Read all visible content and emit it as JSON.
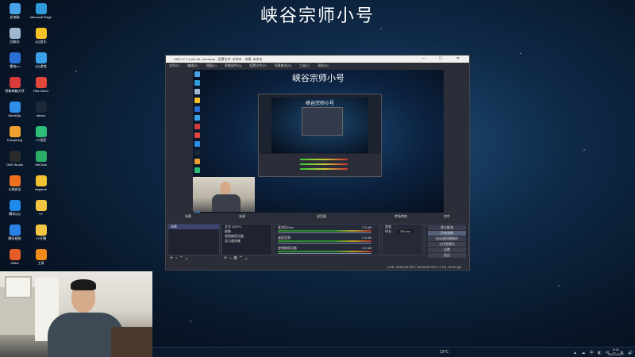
{
  "stream_title": "峡谷宗师小号",
  "desktop_icons": [
    {
      "label": "此电脑",
      "color": "#4aa3e6"
    },
    {
      "label": "Microsoft Edge",
      "color": "#2f9bd8"
    },
    {
      "label": "回收站",
      "color": "#9fb7cf"
    },
    {
      "label": "QQ音乐",
      "color": "#f6c026"
    },
    {
      "label": "雷电Ln",
      "color": "#2a6fd6"
    },
    {
      "label": "QQ游戏",
      "color": "#3aa0e8"
    },
    {
      "label": "网易邮箱大师",
      "color": "#d73b3b"
    },
    {
      "label": "Riot Client",
      "color": "#e0463a"
    },
    {
      "label": "BandiZip",
      "color": "#2f8ee8"
    },
    {
      "label": "steam",
      "color": "#1b2838"
    },
    {
      "label": "Everything",
      "color": "#f0a030"
    },
    {
      "label": "YY语音",
      "color": "#2dbe78"
    },
    {
      "label": "OBS Studio",
      "color": "#2b2b2b"
    },
    {
      "label": "WeChat",
      "color": "#2aae67"
    },
    {
      "label": "火绒安全",
      "color": "#f07020"
    },
    {
      "label": "wegame",
      "color": "#f2c230"
    },
    {
      "label": "腾讯QQ",
      "color": "#1f8ae8"
    },
    {
      "label": "YY",
      "color": "#f4c542"
    },
    {
      "label": "腾讯视频",
      "color": "#2a82e6"
    },
    {
      "label": "YY开播",
      "color": "#f4c542"
    },
    {
      "label": "Office",
      "color": "#e55b2a"
    },
    {
      "label": "工具",
      "color": "#f08a1a"
    }
  ],
  "obs": {
    "title": "OBS 27.1.3 (64-bit, windows) - 配置文件: 未命名 - 场景: 未命名",
    "menu": [
      "文件(F)",
      "编辑(E)",
      "视图(V)",
      "停靠部件(D)",
      "配置文件(P)",
      "场景集合(S)",
      "工具(T)",
      "帮助(H)"
    ],
    "preview_title": "峡谷宗师小号",
    "dock_headers": {
      "scenes": "场景",
      "sources": "来源",
      "mixer": "混音器",
      "transitions": "转场特效",
      "controls": "控件"
    },
    "scenes": [
      "场景"
    ],
    "sources": [
      "文本 (GDI+)",
      "图像",
      "视频捕获设备",
      "显示器采集"
    ],
    "mixer": [
      {
        "name": "麦克风/Aux",
        "db": "0.0 dB"
      },
      {
        "name": "桌面音频",
        "db": "0.0 dB"
      },
      {
        "name": "视频捕获设备",
        "db": "0.0 dB"
      }
    ],
    "transitions": {
      "type": "渐变",
      "duration_label": "时长",
      "duration": "300 ms"
    },
    "controls": [
      "停止推流",
      "开始录制",
      "启动虚拟摄像机",
      "工作室模式",
      "设置",
      "退出"
    ],
    "status": "LIVE: 00:00:00   REC: 00:00:00   CPU: 2.1%, 30.00 fps"
  },
  "taskbar": {
    "tray_icons": "▲ ☁ 中 ◧ ✉ ⌁ ⚙ 🔊",
    "time": "9:44",
    "date": "2021/10/17",
    "weather": "19°C"
  }
}
